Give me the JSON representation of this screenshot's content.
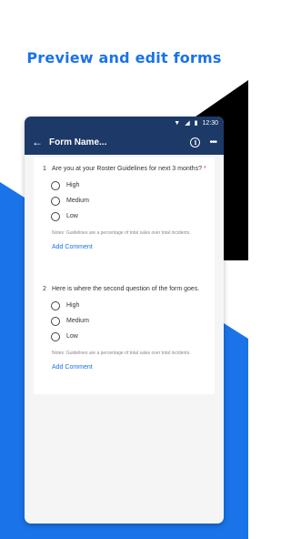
{
  "headline": "Preview and edit forms",
  "colors": {
    "accent": "#1a73e8",
    "appbar": "#1d3967",
    "black_shape": "#000000"
  },
  "status_bar": {
    "time": "12:30",
    "icons": [
      "wifi-icon",
      "signal-icon",
      "battery-icon"
    ]
  },
  "app_bar": {
    "title": "Form Name...",
    "icons": [
      "back-arrow-icon",
      "info-icon",
      "more-icon"
    ]
  },
  "questions": [
    {
      "number": "1",
      "text": "Are you at your Roster Guidelines for next 3 months?",
      "required_mark": "*",
      "options": [
        "High",
        "Medium",
        "Low"
      ],
      "notes": "Notes: Guidelines are a percentage of total sales over total incidents.",
      "add_comment": "Add Comment"
    },
    {
      "number": "2",
      "text": "Here is where the second question of the form goes.",
      "options": [
        "High",
        "Medium",
        "Low"
      ],
      "notes": "Notes: Guidelines are a percentage of total sales over total incidents.",
      "add_comment": "Add Comment"
    }
  ]
}
